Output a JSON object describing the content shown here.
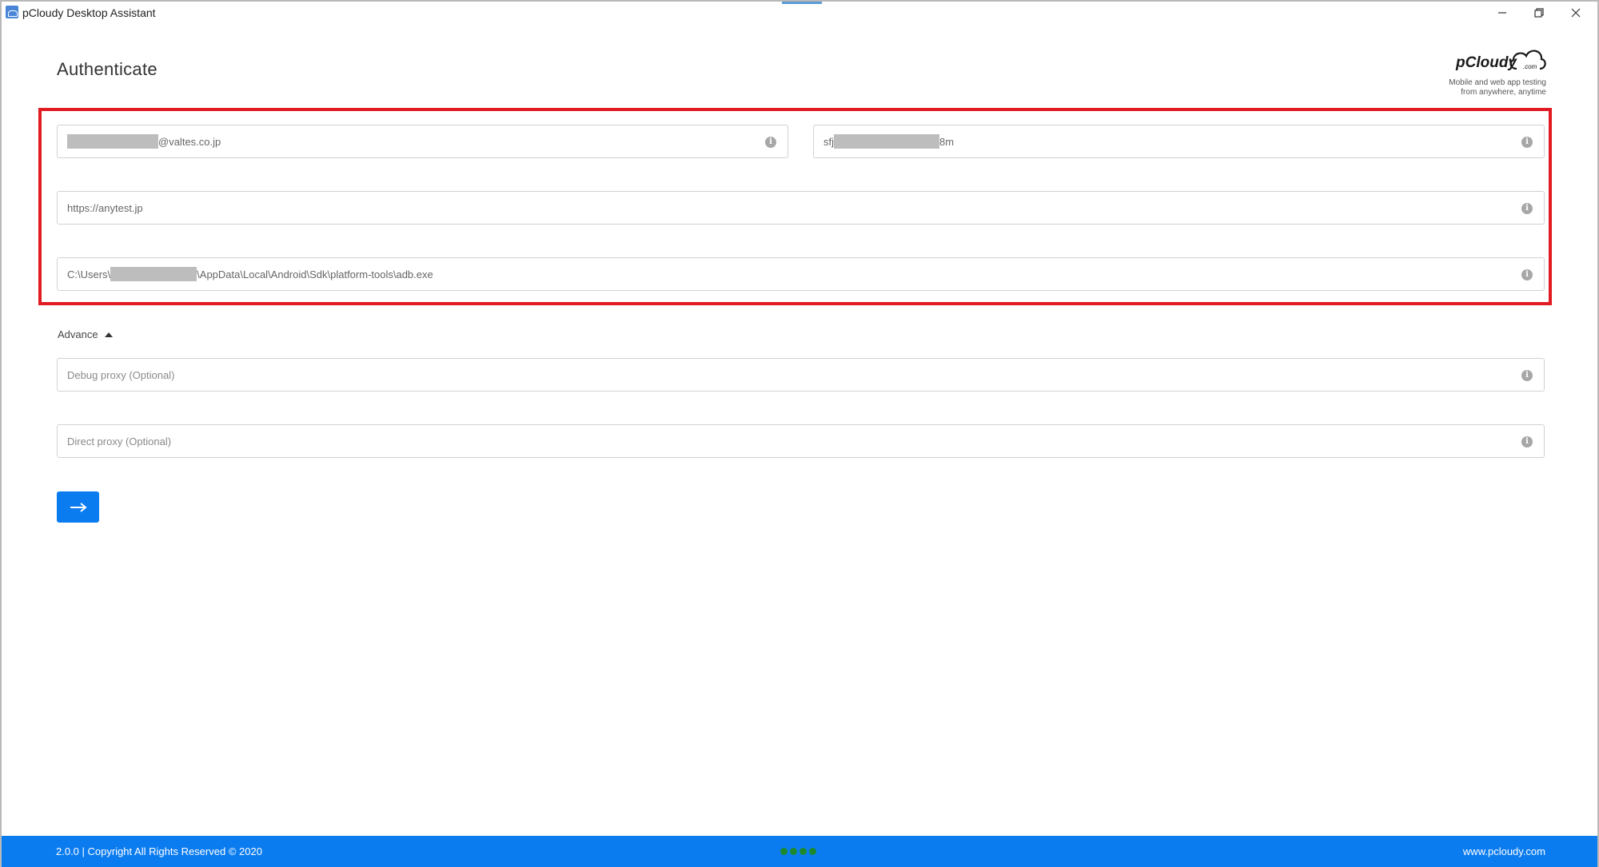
{
  "window": {
    "title": "pCloudy Desktop Assistant"
  },
  "header": {
    "title": "Authenticate",
    "logo_text": "pCloudy",
    "logo_suffix": ".com",
    "tagline_line1": "Mobile and web app testing",
    "tagline_line2": "from anywhere, anytime"
  },
  "form": {
    "email_suffix": "@valtes.co.jp",
    "key_prefix": "sfj",
    "key_suffix": "8m",
    "url": "https://anytest.jp",
    "adb_path_prefix": "C:\\Users\\",
    "adb_path_suffix": "\\AppData\\Local\\Android\\Sdk\\platform-tools\\adb.exe",
    "advance_label": "Advance",
    "debug_proxy_placeholder": "Debug proxy (Optional)",
    "direct_proxy_placeholder": "Direct proxy (Optional)",
    "info_glyph": "i"
  },
  "icons": {
    "submit": "arrow-right-icon",
    "info": "info-icon"
  },
  "footer": {
    "copyright": "2.0.0 | Copyright All Rights Reserved © 2020",
    "website": "www.pcloudy.com"
  },
  "colors": {
    "accent": "#0b7cf0",
    "highlight": "#e11b22",
    "status_dots": "#1b8a2e"
  }
}
